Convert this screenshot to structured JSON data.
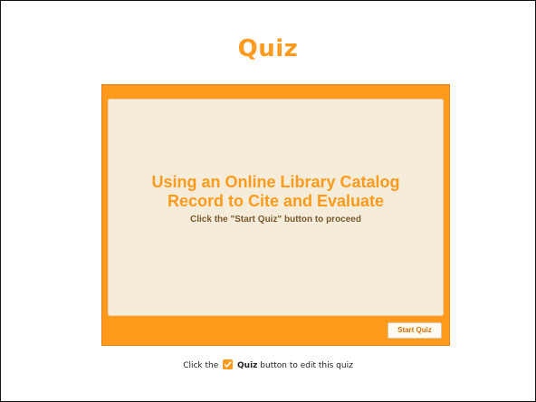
{
  "slide": {
    "title": "Quiz"
  },
  "quiz": {
    "heading_line1": "Using an Online Library Catalog",
    "heading_line2": "Record to Cite and Evaluate",
    "instruction": "Click the \"Start Quiz\" button to proceed",
    "start_button_label": "Start Quiz"
  },
  "hint": {
    "prefix": "Click the",
    "button_name": "Quiz",
    "suffix": "button to edit this quiz",
    "icon": "quiz-checkmark-icon"
  },
  "colors": {
    "accent": "#ff9a1c",
    "panel_background": "#f5ecda",
    "instruction_text": "#7a5a2c"
  }
}
